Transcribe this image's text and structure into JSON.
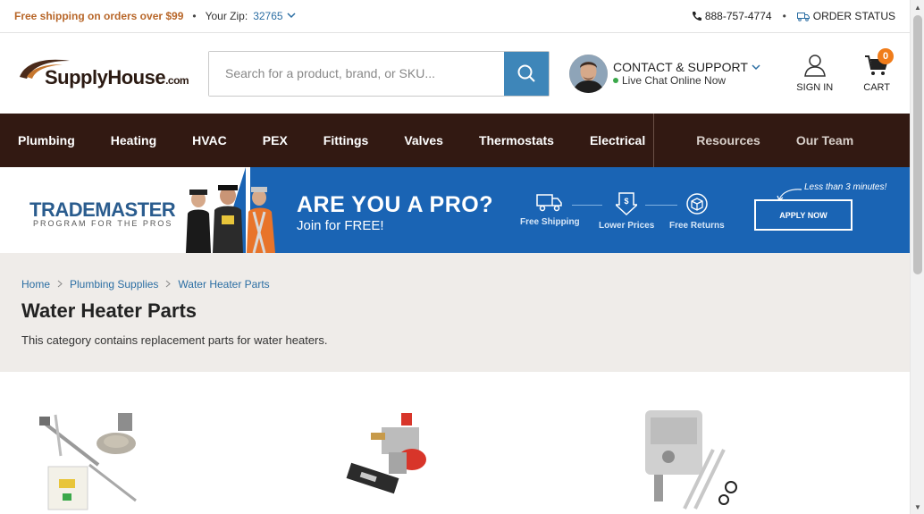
{
  "topbar": {
    "shipping": "Free shipping on orders over $99",
    "zip_label": "Your Zip:",
    "zip_value": "32765",
    "phone": "888-757-4774",
    "order_status": "ORDER STATUS"
  },
  "header": {
    "logo_brand": "SupplyHouse",
    "logo_suffix": ".com",
    "search_placeholder": "Search for a product, brand, or SKU...",
    "support_title": "CONTACT & SUPPORT",
    "support_status": "Live Chat Online Now",
    "sign_in": "SIGN IN",
    "cart": "CART",
    "cart_count": "0"
  },
  "nav": {
    "main": [
      "Plumbing",
      "Heating",
      "HVAC",
      "PEX",
      "Fittings",
      "Valves",
      "Thermostats",
      "Electrical"
    ],
    "side": [
      "Resources",
      "Our Team"
    ]
  },
  "banner": {
    "brand": "TRADEMASTER",
    "brand_sub": "PROGRAM FOR THE PROS",
    "headline": "ARE YOU A PRO?",
    "subhead": "Join for FREE!",
    "features": [
      "Free Shipping",
      "Lower Prices",
      "Free Returns"
    ],
    "note": "Less than 3 minutes!",
    "cta": "APPLY NOW"
  },
  "breadcrumb": [
    "Home",
    "Plumbing Supplies",
    "Water Heater Parts"
  ],
  "page": {
    "title": "Water Heater Parts",
    "description": "This category contains replacement parts for water heaters."
  },
  "colors": {
    "nav_bg": "#321912",
    "accent_blue": "#3e86b9",
    "link": "#2b6ea3",
    "shipping": "#b8672a",
    "banner_blue": "#1a64b4",
    "cart_badge": "#f07c1a"
  }
}
